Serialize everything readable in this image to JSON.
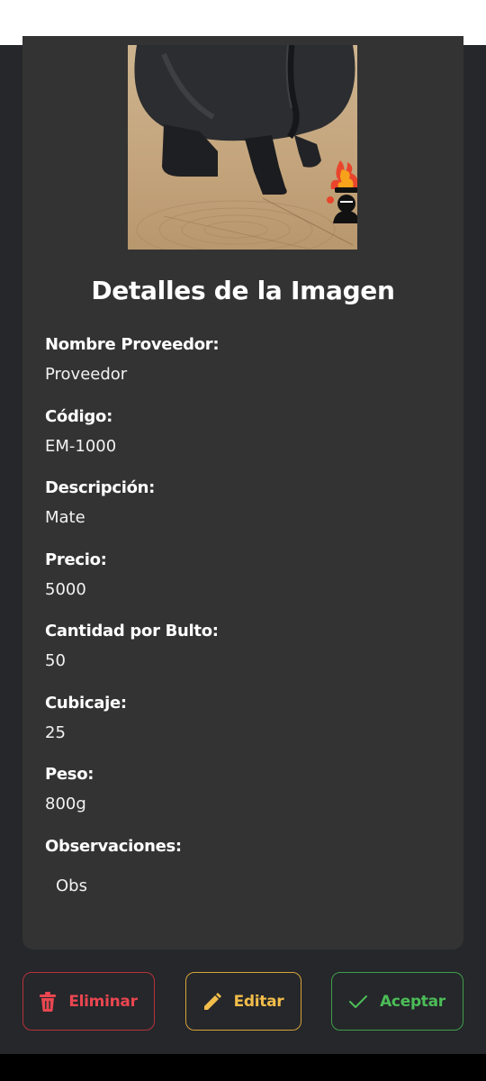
{
  "details": {
    "title": "Detalles de la Imagen",
    "fields": [
      {
        "label": "Nombre Proveedor:",
        "value": "Proveedor"
      },
      {
        "label": "Código:",
        "value": "EM-1000"
      },
      {
        "label": "Descripción:",
        "value": "Mate"
      },
      {
        "label": "Precio:",
        "value": "5000"
      },
      {
        "label": "Cantidad por Bulto:",
        "value": "50"
      },
      {
        "label": "Cubicaje:",
        "value": "25"
      },
      {
        "label": "Peso:",
        "value": "800g"
      },
      {
        "label": "Observaciones:",
        "value": "Obs"
      }
    ]
  },
  "actions": {
    "delete_label": "Eliminar",
    "edit_label": "Editar",
    "accept_label": "Aceptar"
  },
  "colors": {
    "background": "#25272b",
    "card": "#333333",
    "delete": "#ea4650",
    "edit": "#f2bd4a",
    "accept": "#4cbd57"
  },
  "icons": {
    "delete": "trash-icon",
    "edit": "pencil-icon",
    "accept": "check-icon"
  }
}
